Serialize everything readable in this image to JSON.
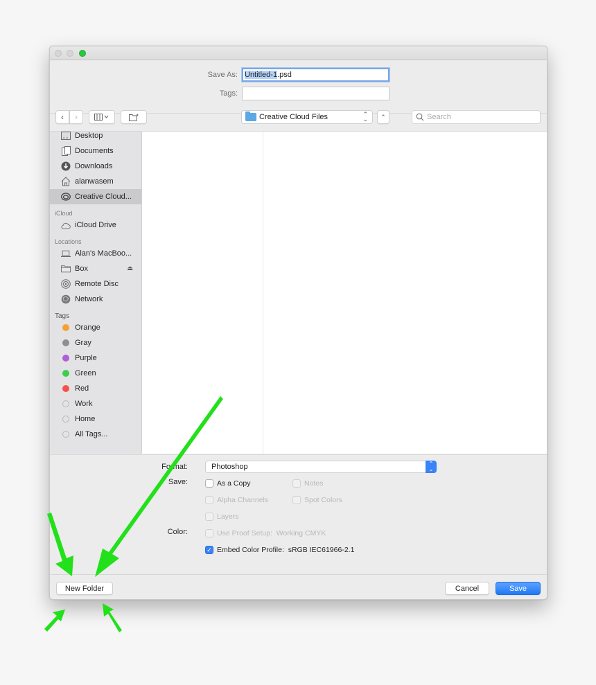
{
  "window": {
    "traffic_lights": [
      "close",
      "minimize",
      "zoom"
    ]
  },
  "header": {
    "save_as_label": "Save As:",
    "filename_selected": "Untitled-1",
    "filename_ext": ".psd",
    "tags_label": "Tags:",
    "tags_value": ""
  },
  "toolbar": {
    "back_icon": "chevron-left",
    "forward_icon": "chevron-right",
    "view_icon": "columns-view",
    "new_folder_icon": "new-folder",
    "location": "Creative Cloud Files",
    "expand_icon": "chevron-up",
    "search_placeholder": "Search"
  },
  "sidebar": {
    "favorites": [
      {
        "label": "Desktop",
        "icon": "desktop-icon"
      },
      {
        "label": "Documents",
        "icon": "documents-icon"
      },
      {
        "label": "Downloads",
        "icon": "downloads-icon"
      },
      {
        "label": "alanwasem",
        "icon": "home-icon"
      },
      {
        "label": "Creative Cloud...",
        "icon": "creative-cloud-icon",
        "selected": true
      }
    ],
    "icloud_header": "iCloud",
    "icloud": [
      {
        "label": "iCloud Drive",
        "icon": "cloud-icon"
      }
    ],
    "locations_header": "Locations",
    "locations": [
      {
        "label": "Alan's MacBoo...",
        "icon": "laptop-icon"
      },
      {
        "label": "Box",
        "icon": "folder-icon",
        "eject": true
      },
      {
        "label": "Remote Disc",
        "icon": "disc-icon"
      },
      {
        "label": "Network",
        "icon": "network-icon"
      }
    ],
    "tags_header": "Tags",
    "tags": [
      {
        "label": "Orange",
        "color": "#f7a033"
      },
      {
        "label": "Gray",
        "color": "#8e8e93"
      },
      {
        "label": "Purple",
        "color": "#b05fd9"
      },
      {
        "label": "Green",
        "color": "#3ccf4e"
      },
      {
        "label": "Red",
        "color": "#f9504a"
      },
      {
        "label": "Work",
        "color": ""
      },
      {
        "label": "Home",
        "color": ""
      },
      {
        "label": "All Tags...",
        "color": ""
      }
    ]
  },
  "options": {
    "format_label": "Format:",
    "format_value": "Photoshop",
    "save_label": "Save:",
    "color_label": "Color:",
    "checkboxes": {
      "as_a_copy": {
        "label": "As a Copy",
        "checked": false,
        "enabled": true
      },
      "notes": {
        "label": "Notes",
        "checked": false,
        "enabled": false
      },
      "alpha_channels": {
        "label": "Alpha Channels",
        "checked": false,
        "enabled": false
      },
      "spot_colors": {
        "label": "Spot Colors",
        "checked": false,
        "enabled": false
      },
      "layers": {
        "label": "Layers",
        "checked": false,
        "enabled": false
      },
      "use_proof_setup": {
        "label": "Use Proof Setup:  Working CMYK",
        "checked": false,
        "enabled": false
      },
      "embed_color_profile": {
        "label": "Embed Color Profile:  sRGB IEC61966-2.1",
        "checked": true,
        "enabled": true
      }
    }
  },
  "footer": {
    "new_folder": "New Folder",
    "cancel": "Cancel",
    "save": "Save"
  },
  "annotations": {
    "arrow_color": "#22e01a"
  }
}
